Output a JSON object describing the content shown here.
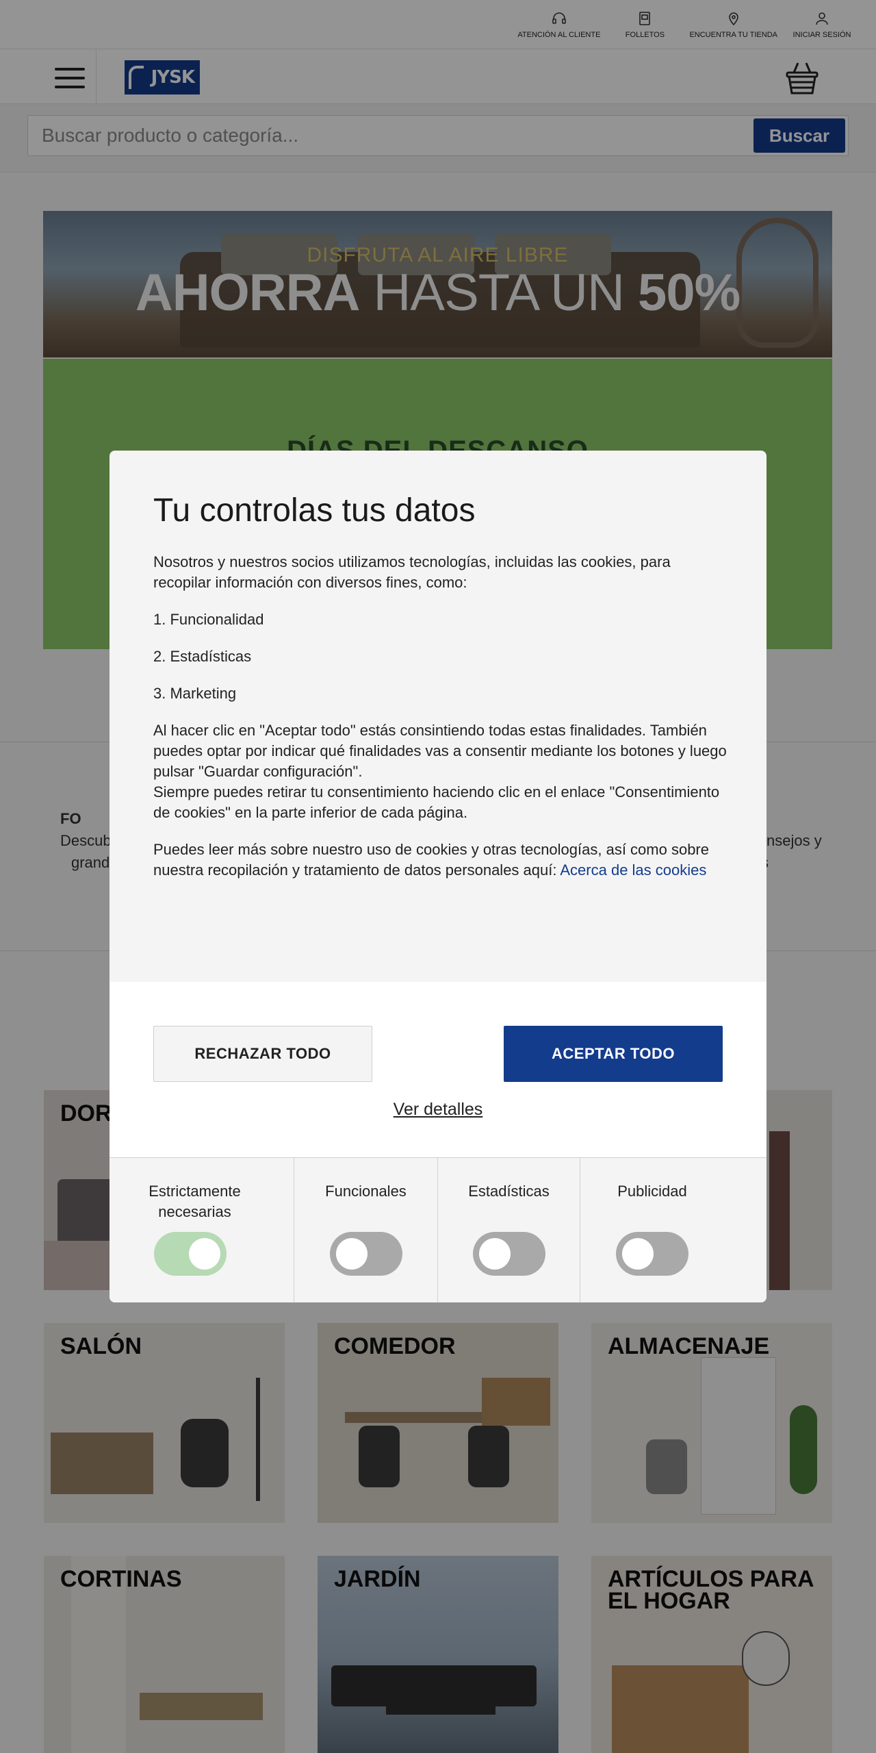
{
  "utility_nav": [
    {
      "label": "ATENCIÓN AL CLIENTE",
      "icon": "headset-icon"
    },
    {
      "label": "FOLLETOS",
      "icon": "brochure-icon"
    },
    {
      "label": "ENCUENTRA TU TIENDA",
      "icon": "map-pin-icon"
    },
    {
      "label": "INICIAR SESIÓN",
      "icon": "user-icon"
    }
  ],
  "header": {
    "logo_text": "JYSK",
    "menu_icon": "hamburger-icon",
    "cart_icon": "basket-icon"
  },
  "search": {
    "placeholder": "Buscar producto o categoría...",
    "button_label": "Buscar"
  },
  "hero": {
    "sup_text": "DISFRUTA AL AIRE LIBRE",
    "main_bold": "AHORRA",
    "main_light": " HASTA UN ",
    "main_pct": "50%"
  },
  "promo": {
    "title": "DÍAS DEL DESCANSO",
    "bg_color": "#8ec96a"
  },
  "usp": {
    "left_title_partial": "FO",
    "left_line1": "Descub",
    "left_line2": "grand",
    "right_line1": "nsejos y",
    "right_line2": "s"
  },
  "categories": [
    {
      "label": "DOR"
    },
    {
      "label": "SALÓN"
    },
    {
      "label": "COMEDOR"
    },
    {
      "label": "ALMACENAJE"
    },
    {
      "label": "CORTINAS"
    },
    {
      "label": "JARDÍN"
    },
    {
      "label": "ARTÍCULOS PARA EL HOGAR"
    }
  ],
  "consent": {
    "title": "Tu controlas tus datos",
    "intro": "Nosotros y nuestros socios utilizamos tecnologías, incluidas las cookies, para recopilar información con diversos fines, como:",
    "purposes": [
      "1. Funcionalidad",
      "2. Estadísticas",
      "3. Marketing"
    ],
    "explain": "Al hacer clic en \"Aceptar todo\" estás consintiendo todas estas finalidades. También puedes optar por indicar qué finalidades vas a consentir mediante los botones y luego pulsar \"Guardar configuración\".",
    "withdraw": "Siempre puedes retirar tu consentimiento haciendo clic en el enlace \"Consentimiento de cookies\" en la parte inferior de cada página.",
    "more_text": "Puedes leer más sobre nuestro uso de cookies y otras tecnologías, así como sobre nuestra recopilación y tratamiento de datos personales aquí: ",
    "more_link": "Acerca de las cookies",
    "reject_label": "RECHAZAR TODO",
    "accept_label": "ACEPTAR TODO",
    "details_label": "Ver detalles",
    "toggles": [
      {
        "label": "Estrictamente necesarias",
        "on": true
      },
      {
        "label": "Funcionales",
        "on": false
      },
      {
        "label": "Estadísticas",
        "on": false
      },
      {
        "label": "Publicidad",
        "on": false
      }
    ],
    "colors": {
      "primary": "#143c8c",
      "toggle_on": "#b6dab4",
      "toggle_off": "#a9a9a9"
    }
  }
}
